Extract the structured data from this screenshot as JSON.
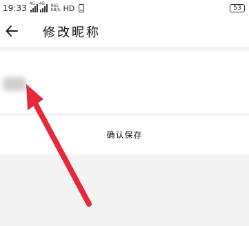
{
  "status_bar": {
    "time": "19:33",
    "signal1_tag": "4G",
    "signal2_tag": "4G",
    "speed_value": "965",
    "speed_unit": "KB/S",
    "hd": "HD",
    "battery": "53"
  },
  "header": {
    "back_icon": "back-arrow",
    "title": "修改昵称"
  },
  "nickname": {
    "value": "",
    "placeholder": ""
  },
  "actions": {
    "save_label": "确认保存"
  },
  "annotation": {
    "arrow_color": "#e8283a"
  },
  "colors": {
    "background": "#f3f3f3",
    "surface": "#ffffff",
    "text": "#111111"
  }
}
